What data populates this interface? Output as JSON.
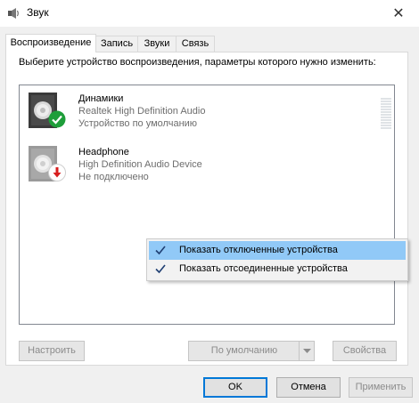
{
  "window": {
    "title": "Звук",
    "close_glyph": "✕"
  },
  "tabs": [
    {
      "label": "Воспроизведение",
      "active": true
    },
    {
      "label": "Запись",
      "active": false
    },
    {
      "label": "Звуки",
      "active": false
    },
    {
      "label": "Связь",
      "active": false
    }
  ],
  "instruction": "Выберите устройство воспроизведения, параметры которого нужно изменить:",
  "devices": [
    {
      "name": "Динамики",
      "line1": "Realtek High Definition Audio",
      "line2": "Устройство по умолчанию",
      "status_icon": "default-check-icon",
      "status_color": "#1e9e3a"
    },
    {
      "name": "Headphone",
      "line1": "High Definition Audio Device",
      "line2": "Не подключено",
      "status_icon": "unplugged-arrow-icon",
      "status_color": "#d81e1e"
    }
  ],
  "context_menu": {
    "items": [
      {
        "label": "Показать отключенные устройства",
        "checked": true
      },
      {
        "label": "Показать отсоединенные устройства",
        "checked": true
      }
    ]
  },
  "panel_buttons": {
    "configure": "Настроить",
    "default": "По умолчанию",
    "properties": "Свойства"
  },
  "dialog_buttons": {
    "ok": "OK",
    "cancel": "Отмена",
    "apply": "Применить"
  },
  "colors": {
    "accent": "#0078d7",
    "menu_hover": "#91c9f7",
    "check": "#1e9e3a"
  }
}
